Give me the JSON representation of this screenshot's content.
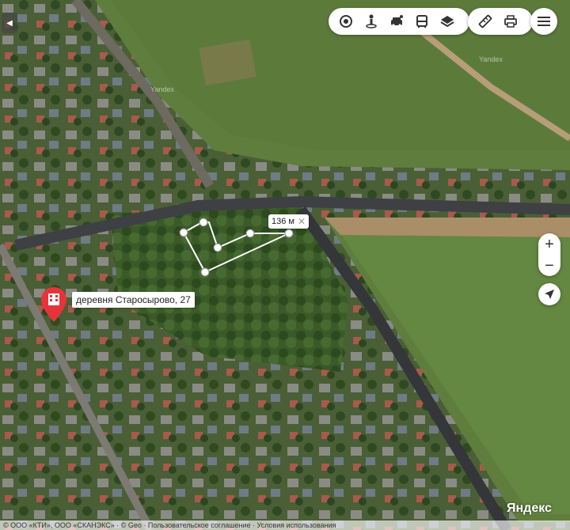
{
  "map": {
    "ruler_distance": "136 м",
    "ruler_close_icon": "close-icon",
    "place_label": "деревня Старосырово, 27",
    "logo": "Яндекс",
    "watermark": "Yandex",
    "copyright": "© ООО «КТИ», ООО «СКАНЭКС» · © Geo · Пользовательское соглашение · Условия использования"
  },
  "toolbar": {
    "icons": [
      "panorama-icon",
      "streetview-icon",
      "traffic-icon",
      "transit-icon",
      "layers-icon"
    ],
    "tools": [
      "ruler-icon",
      "print-icon"
    ],
    "menu": "menu-icon"
  },
  "controls": {
    "zoom_in": "+",
    "zoom_out": "−",
    "back": "◀"
  },
  "colors": {
    "pin": "#e8333a",
    "route": "#ffffff"
  }
}
